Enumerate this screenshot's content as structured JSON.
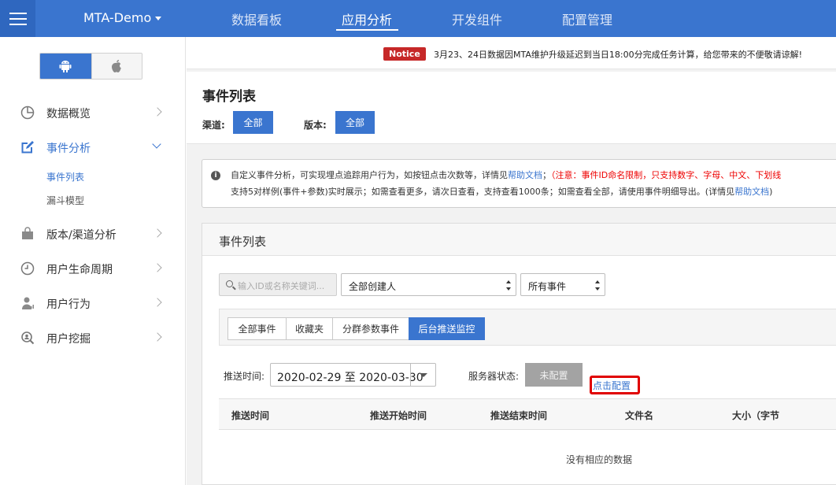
{
  "topbar": {
    "app_title": "MTA-Demo",
    "nav": [
      "数据看板",
      "应用分析",
      "开发组件",
      "配置管理"
    ],
    "active_nav": "应用分析",
    "background": "#3a75cf"
  },
  "sidebar": {
    "platforms": [
      "android-icon",
      "apple-icon"
    ],
    "selected_platform": "android",
    "items": [
      {
        "label": "数据概览",
        "icon": "pie-chart-icon"
      },
      {
        "label": "事件分析",
        "icon": "edit-icon"
      },
      {
        "label": "版本/渠道分析",
        "icon": "bag-icon"
      },
      {
        "label": "用户生命周期",
        "icon": "clock-icon"
      },
      {
        "label": "用户行为",
        "icon": "user-icon"
      },
      {
        "label": "用户挖掘",
        "icon": "search-user-icon"
      }
    ],
    "sub_items": [
      "事件列表",
      "漏斗模型"
    ],
    "active_sub": "事件列表"
  },
  "notice": {
    "badge": "Notice",
    "text": "3月23、24日数据因MTA维护升级延迟到当日18:00分完成任务计算，给您带来的不便敬请谅解!"
  },
  "header": {
    "title": "事件列表",
    "channel_label": "渠道:",
    "channel_value": "全部",
    "version_label": "版本:",
    "version_value": "全部"
  },
  "info": {
    "line1_a": "自定义事件分析，可实现埋点追踪用户行为，如按钮点击次数等，详情见",
    "line1_link": "帮助文档",
    "line1_sep": "；",
    "line1_red": "（注意：事件ID命名限制，只支持数字、字母、中文、下划线",
    "line2_a": "支持5对样例(事件+参数)实时展示；如需查看更多，请次日查看，支持查看1000条；如需查看全部，请使用事件明细导出。(详情见",
    "line2_link": "帮助文档",
    "line2_end": ")"
  },
  "list": {
    "title": "事件列表",
    "search_placeholder": "输入ID或名称关键词...",
    "creator_select": "全部创建人",
    "event_select": "所有事件",
    "tabs": [
      "全部事件",
      "收藏夹",
      "分群参数事件",
      "后台推送监控"
    ],
    "active_tab": "后台推送监控",
    "push_time_label": "推送时间:",
    "date_range": "2020-02-29 至 2020-03-30",
    "server_status_label": "服务器状态:",
    "server_status_value": "未配置",
    "config_link": "点击配置",
    "columns": [
      "推送时间",
      "推送开始时间",
      "推送结束时间",
      "文件名",
      "大小（字节"
    ],
    "empty_text": "没有相应的数据"
  }
}
